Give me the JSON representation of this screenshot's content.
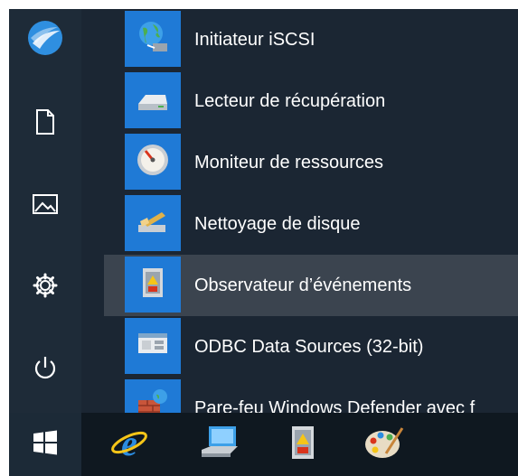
{
  "start_menu": {
    "apps": [
      {
        "label": "Initiateur iSCSI",
        "icon": "globe-network-icon"
      },
      {
        "label": "Lecteur de récupération",
        "icon": "recovery-drive-icon"
      },
      {
        "label": "Moniteur de ressources",
        "icon": "gauge-icon"
      },
      {
        "label": "Nettoyage de disque",
        "icon": "disk-cleanup-icon"
      },
      {
        "label": "Observateur d’événements",
        "icon": "event-viewer-icon",
        "highlighted": true
      },
      {
        "label": "ODBC Data Sources (32-bit)",
        "icon": "odbc-icon"
      },
      {
        "label": "Pare-feu Windows Defender avec f",
        "icon": "firewall-icon"
      }
    ],
    "rail": [
      "user-avatar-icon",
      "document-icon",
      "pictures-icon",
      "settings-gear-icon",
      "power-icon"
    ]
  },
  "taskbar": {
    "start": "windows-logo-icon",
    "pinned": [
      "internet-explorer-icon",
      "computer-icon",
      "event-viewer-icon",
      "paint-icon"
    ]
  },
  "colors": {
    "accent": "#1f7ad6",
    "menu_bg": "#1b2633",
    "taskbar_bg": "#0f1820"
  }
}
